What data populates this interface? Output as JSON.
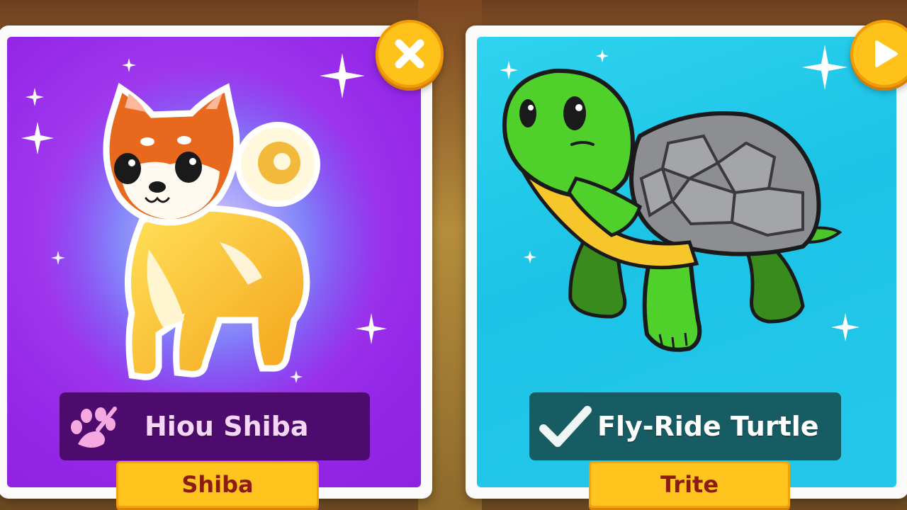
{
  "left_card": {
    "pet_name": "Hiou Shiba",
    "pet_name_prefix": "Hiou",
    "pet_name_suffix": "Shiba",
    "tag_label": "Shiba",
    "badge_icon": "paw-icon",
    "corner_icon": "close-icon",
    "background_color": "#9b2ee8"
  },
  "right_card": {
    "pet_name": "Fly-Ride Turtle",
    "tag_label": "Trite",
    "badge_icon": "checkmark-icon",
    "corner_icon": "play-icon",
    "background_color": "#1fc4e8"
  },
  "colors": {
    "button_yellow": "#ffc21a",
    "left_bar": "#4e0b6e",
    "right_bar": "#175c63",
    "tag_text": "#8b1c12"
  }
}
